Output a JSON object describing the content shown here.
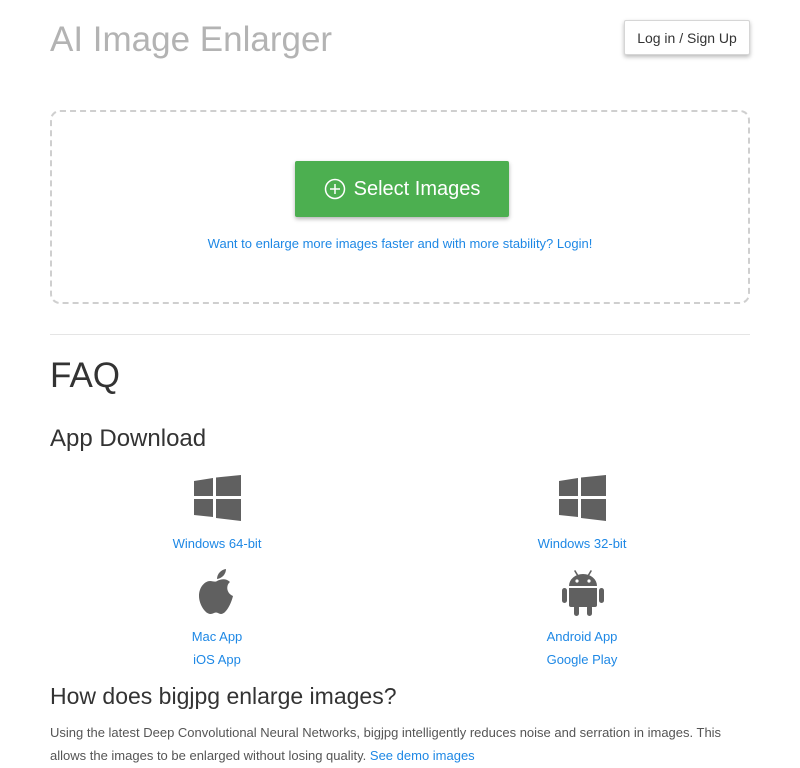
{
  "header": {
    "title": "AI Image Enlarger",
    "login_label": "Log in / Sign Up"
  },
  "upload": {
    "select_label": "Select Images",
    "login_hint": "Want to enlarge more images faster and with more stability? Login!"
  },
  "faq": {
    "title": "FAQ"
  },
  "app_download": {
    "title": "App Download",
    "windows64_label": "Windows 64-bit",
    "windows32_label": "Windows 32-bit",
    "mac_label": "Mac App",
    "ios_label": "iOS App",
    "android_label": "Android App",
    "google_play_label": "Google Play",
    "icons": [
      "windows-icon",
      "windows-icon",
      "apple-icon",
      "android-icon"
    ]
  },
  "how": {
    "title": "How does bigjpg enlarge images?",
    "description": "Using the latest Deep Convolutional Neural Networks, bigjpg intelligently reduces noise and serration in images. This allows the images to be enlarged without losing quality.",
    "demo_link": "See demo images"
  },
  "colors": {
    "accent_green": "#4caf50",
    "link_blue": "#1e88e5",
    "title_gray": "#b3b3b3",
    "icon_gray": "#606060"
  }
}
